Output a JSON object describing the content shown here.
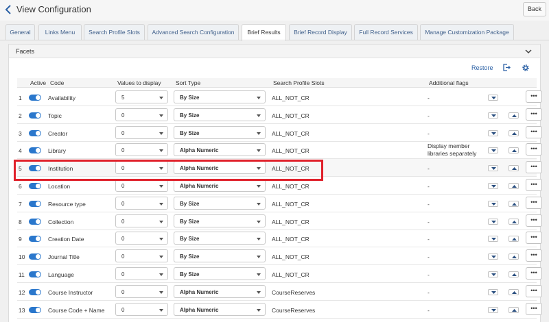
{
  "header": {
    "title": "View Configuration",
    "back_label": "Back"
  },
  "tabs": [
    {
      "label": "General",
      "active": false
    },
    {
      "label": "Links Menu",
      "active": false
    },
    {
      "label": "Search Profile Slots",
      "active": false
    },
    {
      "label": "Advanced Search Configuration",
      "active": false
    },
    {
      "label": "Brief Results",
      "active": true
    },
    {
      "label": "Brief Record Display",
      "active": false
    },
    {
      "label": "Full Record Services",
      "active": false
    },
    {
      "label": "Manage Customization Package",
      "active": false
    }
  ],
  "panel": {
    "title": "Facets",
    "restore_label": "Restore"
  },
  "columns": {
    "active": "Active",
    "code": "Code",
    "values": "Values to display",
    "sort": "Sort Type",
    "slots": "Search Profile Slots",
    "flags": "Additional flags"
  },
  "rows": [
    {
      "num": "1",
      "code": "Availability",
      "values": "5",
      "sort": "By Size",
      "slots": "ALL_NOT_CR",
      "flags": "-",
      "up": false
    },
    {
      "num": "2",
      "code": "Topic",
      "values": "0",
      "sort": "By Size",
      "slots": "ALL_NOT_CR",
      "flags": "-",
      "up": true
    },
    {
      "num": "3",
      "code": "Creator",
      "values": "0",
      "sort": "By Size",
      "slots": "ALL_NOT_CR",
      "flags": "-",
      "up": true
    },
    {
      "num": "4",
      "code": "Library",
      "values": "0",
      "sort": "Alpha Numeric",
      "slots": "ALL_NOT_CR",
      "flags": "Display member libraries separately",
      "up": true
    },
    {
      "num": "5",
      "code": "Institution",
      "values": "0",
      "sort": "Alpha Numeric",
      "slots": "ALL_NOT_CR",
      "flags": "-",
      "up": true
    },
    {
      "num": "6",
      "code": "Location",
      "values": "0",
      "sort": "Alpha Numeric",
      "slots": "ALL_NOT_CR",
      "flags": "-",
      "up": true
    },
    {
      "num": "7",
      "code": "Resource type",
      "values": "0",
      "sort": "By Size",
      "slots": "ALL_NOT_CR",
      "flags": "-",
      "up": true
    },
    {
      "num": "8",
      "code": "Collection",
      "values": "0",
      "sort": "By Size",
      "slots": "ALL_NOT_CR",
      "flags": "-",
      "up": true
    },
    {
      "num": "9",
      "code": "Creation Date",
      "values": "0",
      "sort": "By Size",
      "slots": "ALL_NOT_CR",
      "flags": "-",
      "up": true
    },
    {
      "num": "10",
      "code": "Journal Title",
      "values": "0",
      "sort": "By Size",
      "slots": "ALL_NOT_CR",
      "flags": "-",
      "up": true
    },
    {
      "num": "11",
      "code": "Language",
      "values": "0",
      "sort": "By Size",
      "slots": "ALL_NOT_CR",
      "flags": "-",
      "up": true
    },
    {
      "num": "12",
      "code": "Course Instructor",
      "values": "0",
      "sort": "Alpha Numeric",
      "slots": "CourseReserves",
      "flags": "-",
      "up": true
    },
    {
      "num": "13",
      "code": "Course Code + Name",
      "values": "0",
      "sort": "Alpha Numeric",
      "slots": "CourseReserves",
      "flags": "-",
      "up": true
    }
  ],
  "dots_label": "•••",
  "colors": {
    "accent": "#2a77cc",
    "link": "#2d62a6",
    "highlight": "#e0202a"
  }
}
